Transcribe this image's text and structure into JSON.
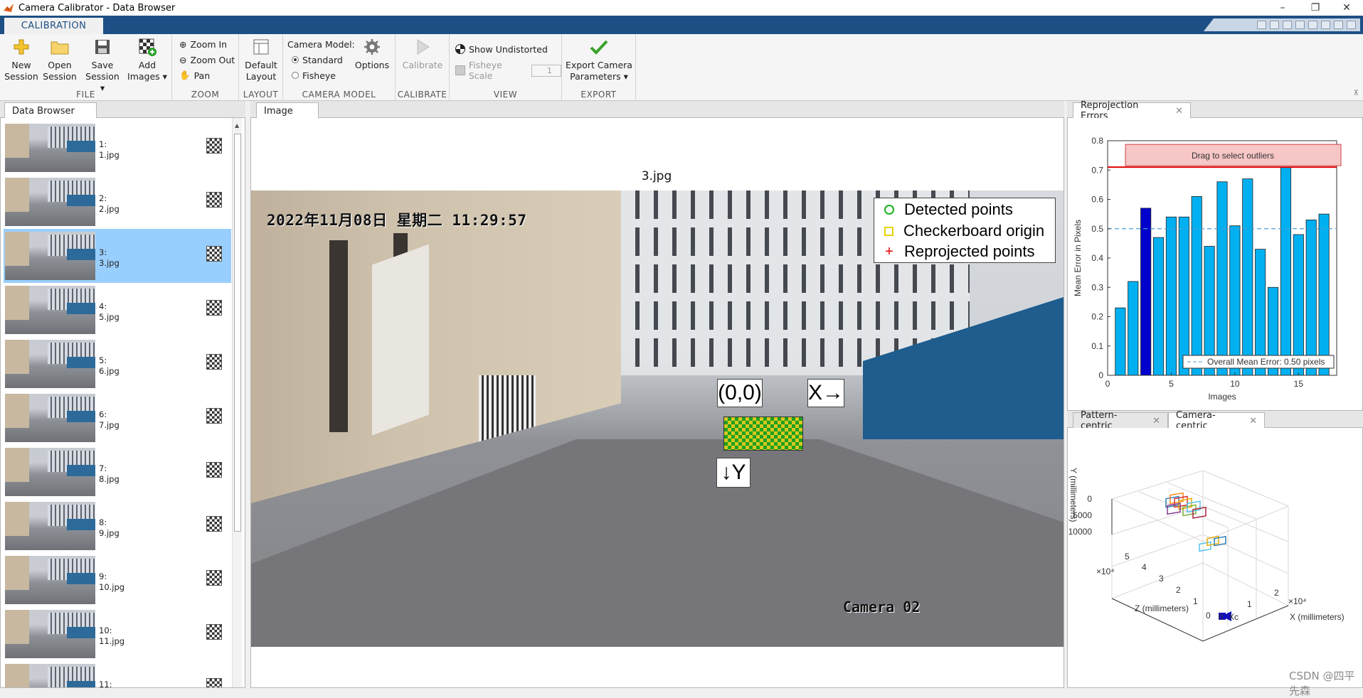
{
  "window": {
    "title": "Camera Calibrator - Data Browser",
    "minimize": "–",
    "restore": "❐",
    "close": "✕"
  },
  "ribbon": {
    "tab": "CALIBRATION",
    "file": {
      "label": "FILE",
      "new": [
        "New",
        "Session"
      ],
      "open": [
        "Open",
        "Session"
      ],
      "save": [
        "Save",
        "Session ▾"
      ],
      "add": [
        "Add",
        "Images ▾"
      ]
    },
    "zoom": {
      "label": "ZOOM",
      "zoom_in": "Zoom In",
      "zoom_out": "Zoom Out",
      "pan": "Pan"
    },
    "layout": {
      "label": "LAYOUT",
      "default": [
        "Default",
        "Layout"
      ]
    },
    "camera_model": {
      "label": "CAMERA MODEL",
      "title": "Camera Model:",
      "standard": "Standard",
      "fisheye": "Fisheye",
      "options": "Options"
    },
    "calibrate": {
      "label": "CALIBRATE",
      "calibrate": "Calibrate"
    },
    "view": {
      "label": "VIEW",
      "show_undistorted": "Show Undistorted",
      "fisheye_scale": "Fisheye Scale",
      "fisheye_scale_value": "1"
    },
    "export": {
      "label": "EXPORT",
      "export": [
        "Export Camera",
        "Parameters ▾"
      ]
    }
  },
  "browser": {
    "tab": "Data Browser",
    "selected_index": 2,
    "items": [
      {
        "num": "1:",
        "file": "1.jpg"
      },
      {
        "num": "2:",
        "file": "2.jpg"
      },
      {
        "num": "3:",
        "file": "3.jpg"
      },
      {
        "num": "4:",
        "file": "5.jpg"
      },
      {
        "num": "5:",
        "file": "6.jpg"
      },
      {
        "num": "6:",
        "file": "7.jpg"
      },
      {
        "num": "7:",
        "file": "8.jpg"
      },
      {
        "num": "8:",
        "file": "9.jpg"
      },
      {
        "num": "9:",
        "file": "10.jpg"
      },
      {
        "num": "10:",
        "file": "11.jpg"
      },
      {
        "num": "11:",
        "file": ""
      }
    ]
  },
  "image_panel": {
    "tab": "Image",
    "title": "3.jpg",
    "timestamp": "2022年11月08日 星期二 11:29:57",
    "camera_label": "Camera 02",
    "origin_label": "(0,0)",
    "x_label": "X→",
    "y_label": "↓Y",
    "legend": [
      "Detected points",
      "Checkerboard origin",
      "Reprojected points"
    ]
  },
  "reprojection": {
    "tab": "Reprojection Errors",
    "button": "Drag to select outliers"
  },
  "extrinsics": {
    "tabs": [
      "Pattern-centric",
      "Camera-centric"
    ],
    "active_tab": "Camera-centric",
    "zlabel": "Z (millimeters)",
    "xlabel": "X (millimeters)",
    "ylabel": "Y (millimeters)",
    "z_exp": "×10⁴",
    "x_exp": "×10⁴",
    "y_ticks": [
      "0",
      "5000",
      "10000"
    ],
    "z_ticks": [
      "5",
      "4",
      "3",
      "2",
      "1",
      "0"
    ],
    "x_ticks": [
      "0",
      "1",
      "2"
    ],
    "camera_axis": "Xc"
  },
  "chart_data": {
    "type": "bar",
    "xlabel": "Images",
    "ylabel": "Mean Error in Pixels",
    "ylim": [
      0,
      0.8
    ],
    "xlim": [
      0,
      18
    ],
    "x_ticks": [
      0,
      5,
      10,
      15
    ],
    "y_ticks": [
      0,
      0.1,
      0.2,
      0.3,
      0.4,
      0.5,
      0.6,
      0.7,
      0.8
    ],
    "categories": [
      1,
      2,
      3,
      4,
      5,
      6,
      7,
      8,
      9,
      10,
      11,
      12,
      13,
      14,
      15,
      16,
      17
    ],
    "values": [
      0.23,
      0.32,
      0.57,
      0.47,
      0.54,
      0.54,
      0.61,
      0.44,
      0.66,
      0.51,
      0.67,
      0.43,
      0.3,
      0.71,
      0.48,
      0.53,
      0.55
    ],
    "highlight_index": 2,
    "mean_error": 0.5,
    "mean_label": "Overall Mean Error: 0.50 pixels",
    "threshold": 0.71,
    "colors": {
      "bar": "#00b0f0",
      "selected": "#0000cc",
      "threshold": "#e00000",
      "mean": "#4f9fd6"
    }
  },
  "watermark": "CSDN @四平先森"
}
